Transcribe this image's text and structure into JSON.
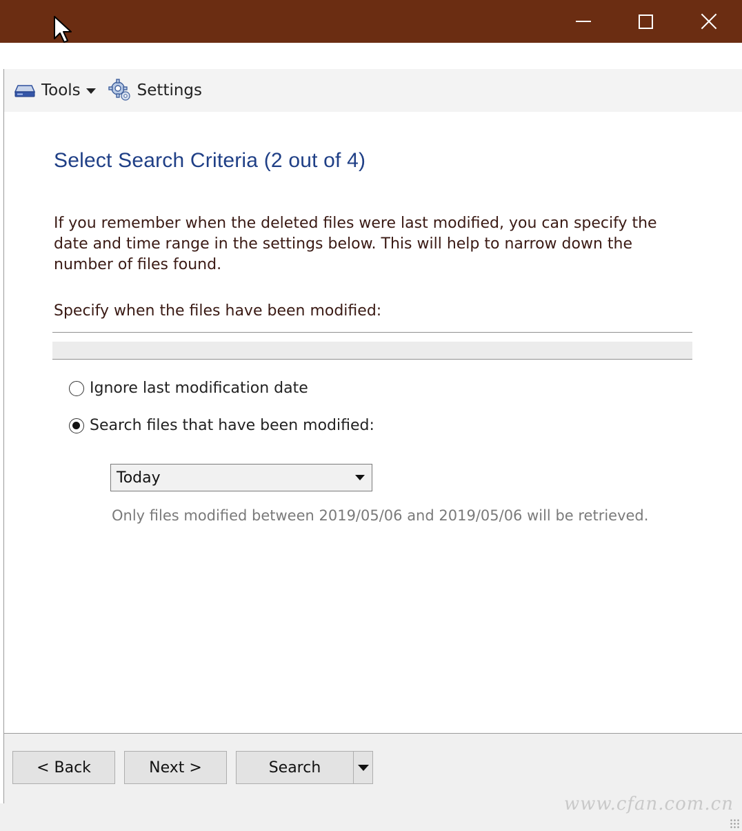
{
  "window": {
    "controls": [
      "minimize",
      "maximize",
      "close"
    ],
    "title_bar_color": "#6b2d12"
  },
  "toolbar": {
    "tools_label": "Tools",
    "settings_label": "Settings"
  },
  "page": {
    "heading": "Select Search Criteria (2 out of 4)",
    "description": "If you remember when the deleted files were last modified, you can specify the date and time range in the settings below. This will help to narrow down the number of files found.",
    "specify_label": "Specify when the files have been modified:",
    "options": [
      {
        "label": "Ignore last modification date",
        "checked": false
      },
      {
        "label": "Search files that have been modified:",
        "checked": true
      }
    ],
    "date_range_select": {
      "value": "Today"
    },
    "info_text": "Only files modified between 2019/05/06 and 2019/05/06 will be retrieved."
  },
  "footer": {
    "back_label": "< Back",
    "next_label": "Next >",
    "search_label": "Search"
  },
  "watermark": "www.cfan.com.cn",
  "colors": {
    "heading": "#1f3f86",
    "body_text": "#3a1a14",
    "info_text": "#7a7a7a"
  }
}
